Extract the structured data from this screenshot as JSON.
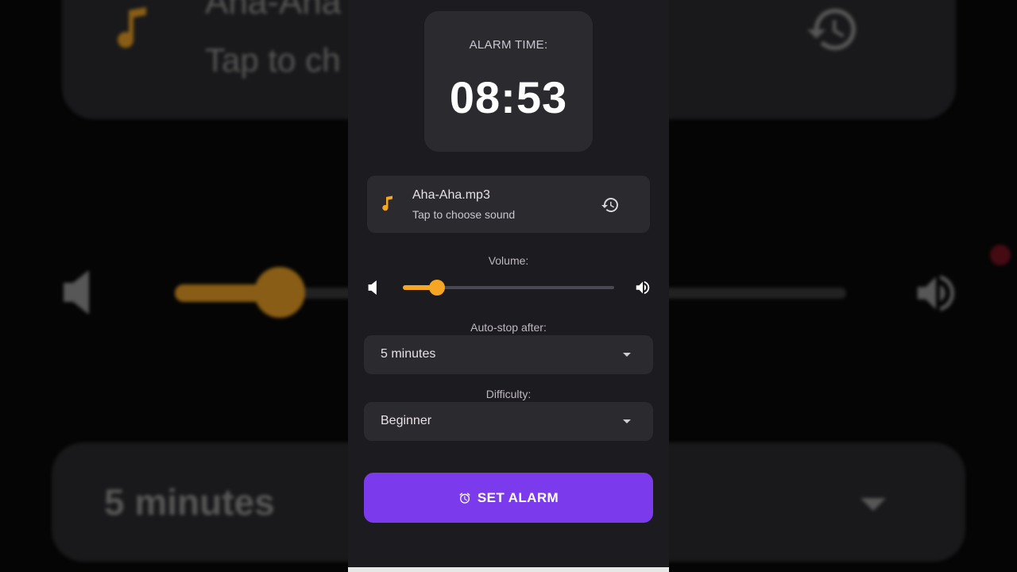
{
  "alarm": {
    "label": "ALARM TIME:",
    "time": "08:53"
  },
  "sound": {
    "title": "Aha-Aha.mp3",
    "subtitle": "Tap to choose sound",
    "icon": "music-note-icon",
    "history_icon": "history-icon"
  },
  "volume": {
    "label": "Volume:",
    "value_percent": 16,
    "low_icon": "volume-low-icon",
    "high_icon": "volume-high-icon"
  },
  "auto_stop": {
    "label": "Auto-stop after:",
    "selected": "5 minutes"
  },
  "difficulty": {
    "label": "Difficulty:",
    "selected": "Beginner"
  },
  "set_alarm": {
    "label": "SET ALARM",
    "icon": "alarm-clock-icon"
  },
  "background": {
    "title": "Aha-Aha",
    "subtitle": "Tap to ch",
    "dropdown_value": "5 minutes"
  },
  "colors": {
    "accent": "#f5a623",
    "primary": "#7c3aed",
    "surface": "#2b2a2f",
    "screen": "#1c1b1f"
  }
}
